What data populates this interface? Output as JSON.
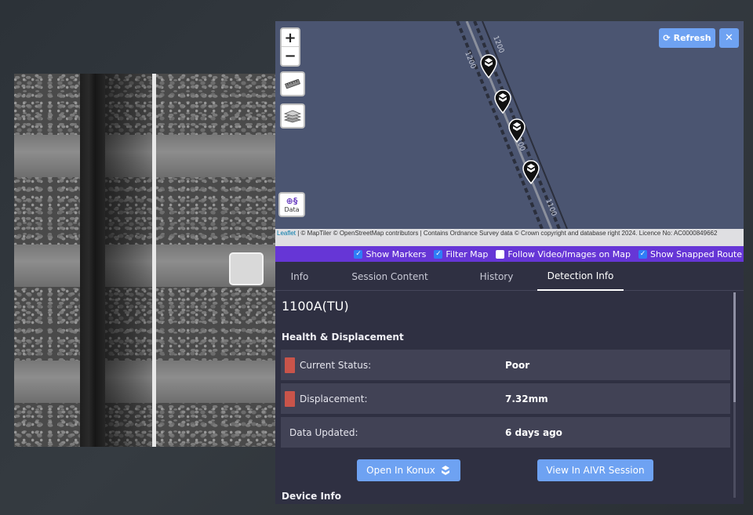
{
  "map": {
    "refresh_label": "Refresh",
    "close_label": "✕",
    "zoom_in": "+",
    "zoom_out": "−",
    "data_control_label": "Data",
    "track_labels": [
      "1200",
      "1200",
      "1100",
      "1100"
    ],
    "attribution_link": "Leaflet",
    "attribution_text": " | © MapTiler © OpenStreetMap contributors | Contains Ordnance Survey data © Crown copyright and database right 2024. Licence No: AC0000849662",
    "icons": {
      "zoom_in": "plus-icon",
      "zoom_out": "minus-icon",
      "ruler": "ruler-icon",
      "layers": "layers-icon",
      "refresh": "refresh-icon",
      "close": "close-icon",
      "marker": "map-marker-icon"
    }
  },
  "options": [
    {
      "label": "Show Markers",
      "checked": true
    },
    {
      "label": "Filter Map",
      "checked": true
    },
    {
      "label": "Follow Video/Images on Map",
      "checked": false
    },
    {
      "label": "Show Snapped Route",
      "checked": true
    }
  ],
  "tabs": [
    {
      "label": "Info",
      "active": false
    },
    {
      "label": "Session Content",
      "active": false
    },
    {
      "label": "History",
      "active": false
    },
    {
      "label": "Detection Info",
      "active": true
    }
  ],
  "detection": {
    "asset_id": "1100A(TU)",
    "health_title": "Health & Displacement",
    "rows": [
      {
        "label": "Current Status:",
        "value": "Poor",
        "status_color": "#c9544a"
      },
      {
        "label": "Displacement:",
        "value": "7.32mm",
        "status_color": "#c9544a"
      },
      {
        "label": "Data Updated:",
        "value": "6 days ago"
      }
    ],
    "open_konux_label": "Open In Konux",
    "view_aivr_label": "View In AIVR Session",
    "device_info_title": "Device Info"
  },
  "colors": {
    "accent": "#6ea2f2",
    "options_bar": "#6636d6",
    "panel_bg": "#2f3042",
    "status_poor": "#c9544a"
  }
}
